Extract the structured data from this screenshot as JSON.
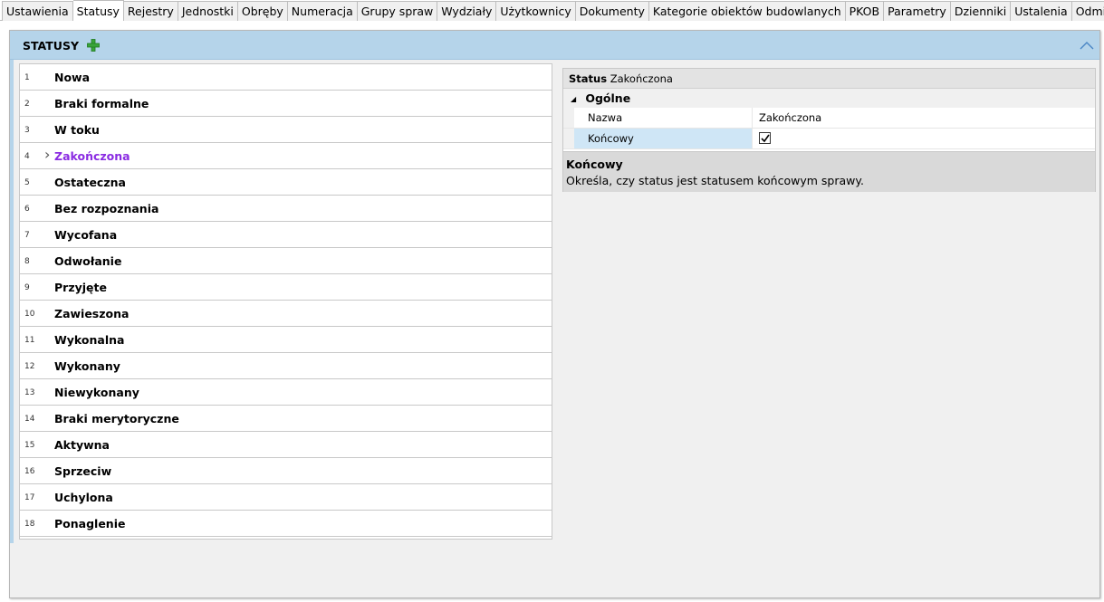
{
  "tabs": [
    {
      "label": "Ustawienia"
    },
    {
      "label": "Statusy",
      "active": true
    },
    {
      "label": "Rejestry"
    },
    {
      "label": "Jednostki"
    },
    {
      "label": "Obręby"
    },
    {
      "label": "Numeracja"
    },
    {
      "label": "Grupy spraw"
    },
    {
      "label": "Wydziały"
    },
    {
      "label": "Użytkownicy"
    },
    {
      "label": "Dokumenty"
    },
    {
      "label": "Kategorie obiektów budowlanych"
    },
    {
      "label": "PKOB"
    },
    {
      "label": "Parametry"
    },
    {
      "label": "Dzienniki"
    },
    {
      "label": "Ustalenia"
    },
    {
      "label": "Odmiana"
    }
  ],
  "panel": {
    "title": "STATUSY",
    "add_icon": "plus-icon",
    "collapse_icon": "chevron-up-icon",
    "accent_color": "#b5d4ea"
  },
  "statuses": [
    {
      "num": "1",
      "name": "Nowa"
    },
    {
      "num": "2",
      "name": "Braki formalne"
    },
    {
      "num": "3",
      "name": "W toku"
    },
    {
      "num": "4",
      "name": "Zakończona",
      "selected": true
    },
    {
      "num": "5",
      "name": "Ostateczna"
    },
    {
      "num": "6",
      "name": "Bez rozpoznania"
    },
    {
      "num": "7",
      "name": "Wycofana"
    },
    {
      "num": "8",
      "name": "Odwołanie"
    },
    {
      "num": "9",
      "name": "Przyjęte"
    },
    {
      "num": "10",
      "name": "Zawieszona"
    },
    {
      "num": "11",
      "name": "Wykonalna"
    },
    {
      "num": "12",
      "name": "Wykonany"
    },
    {
      "num": "13",
      "name": "Niewykonany"
    },
    {
      "num": "14",
      "name": "Braki merytoryczne"
    },
    {
      "num": "15",
      "name": "Aktywna"
    },
    {
      "num": "16",
      "name": "Sprzeciw"
    },
    {
      "num": "17",
      "name": "Uchylona"
    },
    {
      "num": "18",
      "name": "Ponaglenie"
    }
  ],
  "selected_color": "#8a2be2",
  "properties": {
    "header_label": "Status",
    "header_value": "Zakończona",
    "category": "Ogólne",
    "name_label": "Nazwa",
    "name_value": "Zakończona",
    "final_label": "Końcowy",
    "final_checked": true,
    "description_title": "Końcowy",
    "description_text": "Określa, czy status jest statusem końcowym sprawy."
  }
}
